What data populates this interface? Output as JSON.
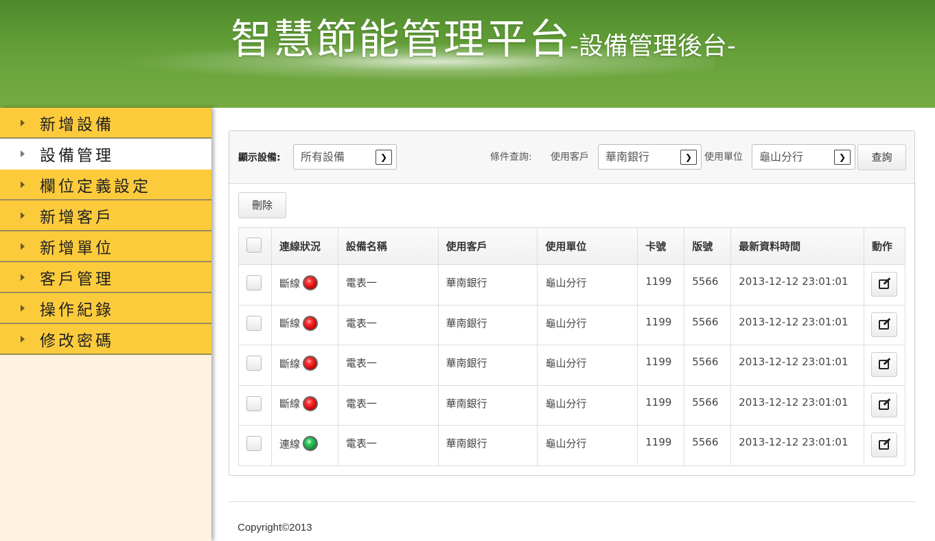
{
  "header": {
    "title": "智慧節能管理平台",
    "subtitle": "-設備管理後台-"
  },
  "sidebar": {
    "items": [
      {
        "label": "新增設備",
        "active": false
      },
      {
        "label": "設備管理",
        "active": true
      },
      {
        "label": "欄位定義設定",
        "active": false
      },
      {
        "label": "新增客戶",
        "active": false
      },
      {
        "label": "新增單位",
        "active": false
      },
      {
        "label": "客戶管理",
        "active": false
      },
      {
        "label": "操作紀錄",
        "active": false
      },
      {
        "label": "修改密碼",
        "active": false
      }
    ]
  },
  "filter": {
    "show_label": "顯示設備:",
    "show_value": "所有設備",
    "condition_label": "條件查詢:",
    "customer_label": "使用客戶",
    "customer_value": "華南銀行",
    "unit_label": "使用單位",
    "unit_value": "龜山分行",
    "query_button": "查詢"
  },
  "actions": {
    "delete_button": "刪除"
  },
  "table": {
    "columns": [
      "連線狀況",
      "設備名稱",
      "使用客戶",
      "使用單位",
      "卡號",
      "版號",
      "最新資料時間",
      "動作"
    ],
    "rows": [
      {
        "status": "斷線",
        "status_color": "red",
        "name": "電表一",
        "customer": "華南銀行",
        "unit": "龜山分行",
        "card": "1199",
        "version": "5566",
        "time": "2013-12-12 23:01:01"
      },
      {
        "status": "斷線",
        "status_color": "red",
        "name": "電表一",
        "customer": "華南銀行",
        "unit": "龜山分行",
        "card": "1199",
        "version": "5566",
        "time": "2013-12-12 23:01:01"
      },
      {
        "status": "斷線",
        "status_color": "red",
        "name": "電表一",
        "customer": "華南銀行",
        "unit": "龜山分行",
        "card": "1199",
        "version": "5566",
        "time": "2013-12-12 23:01:01"
      },
      {
        "status": "斷線",
        "status_color": "red",
        "name": "電表一",
        "customer": "華南銀行",
        "unit": "龜山分行",
        "card": "1199",
        "version": "5566",
        "time": "2013-12-12 23:01:01"
      },
      {
        "status": "連線",
        "status_color": "green",
        "name": "電表一",
        "customer": "華南銀行",
        "unit": "龜山分行",
        "card": "1199",
        "version": "5566",
        "time": "2013-12-12 23:01:01"
      }
    ]
  },
  "footer": {
    "copyright": "Copyright©2013"
  }
}
